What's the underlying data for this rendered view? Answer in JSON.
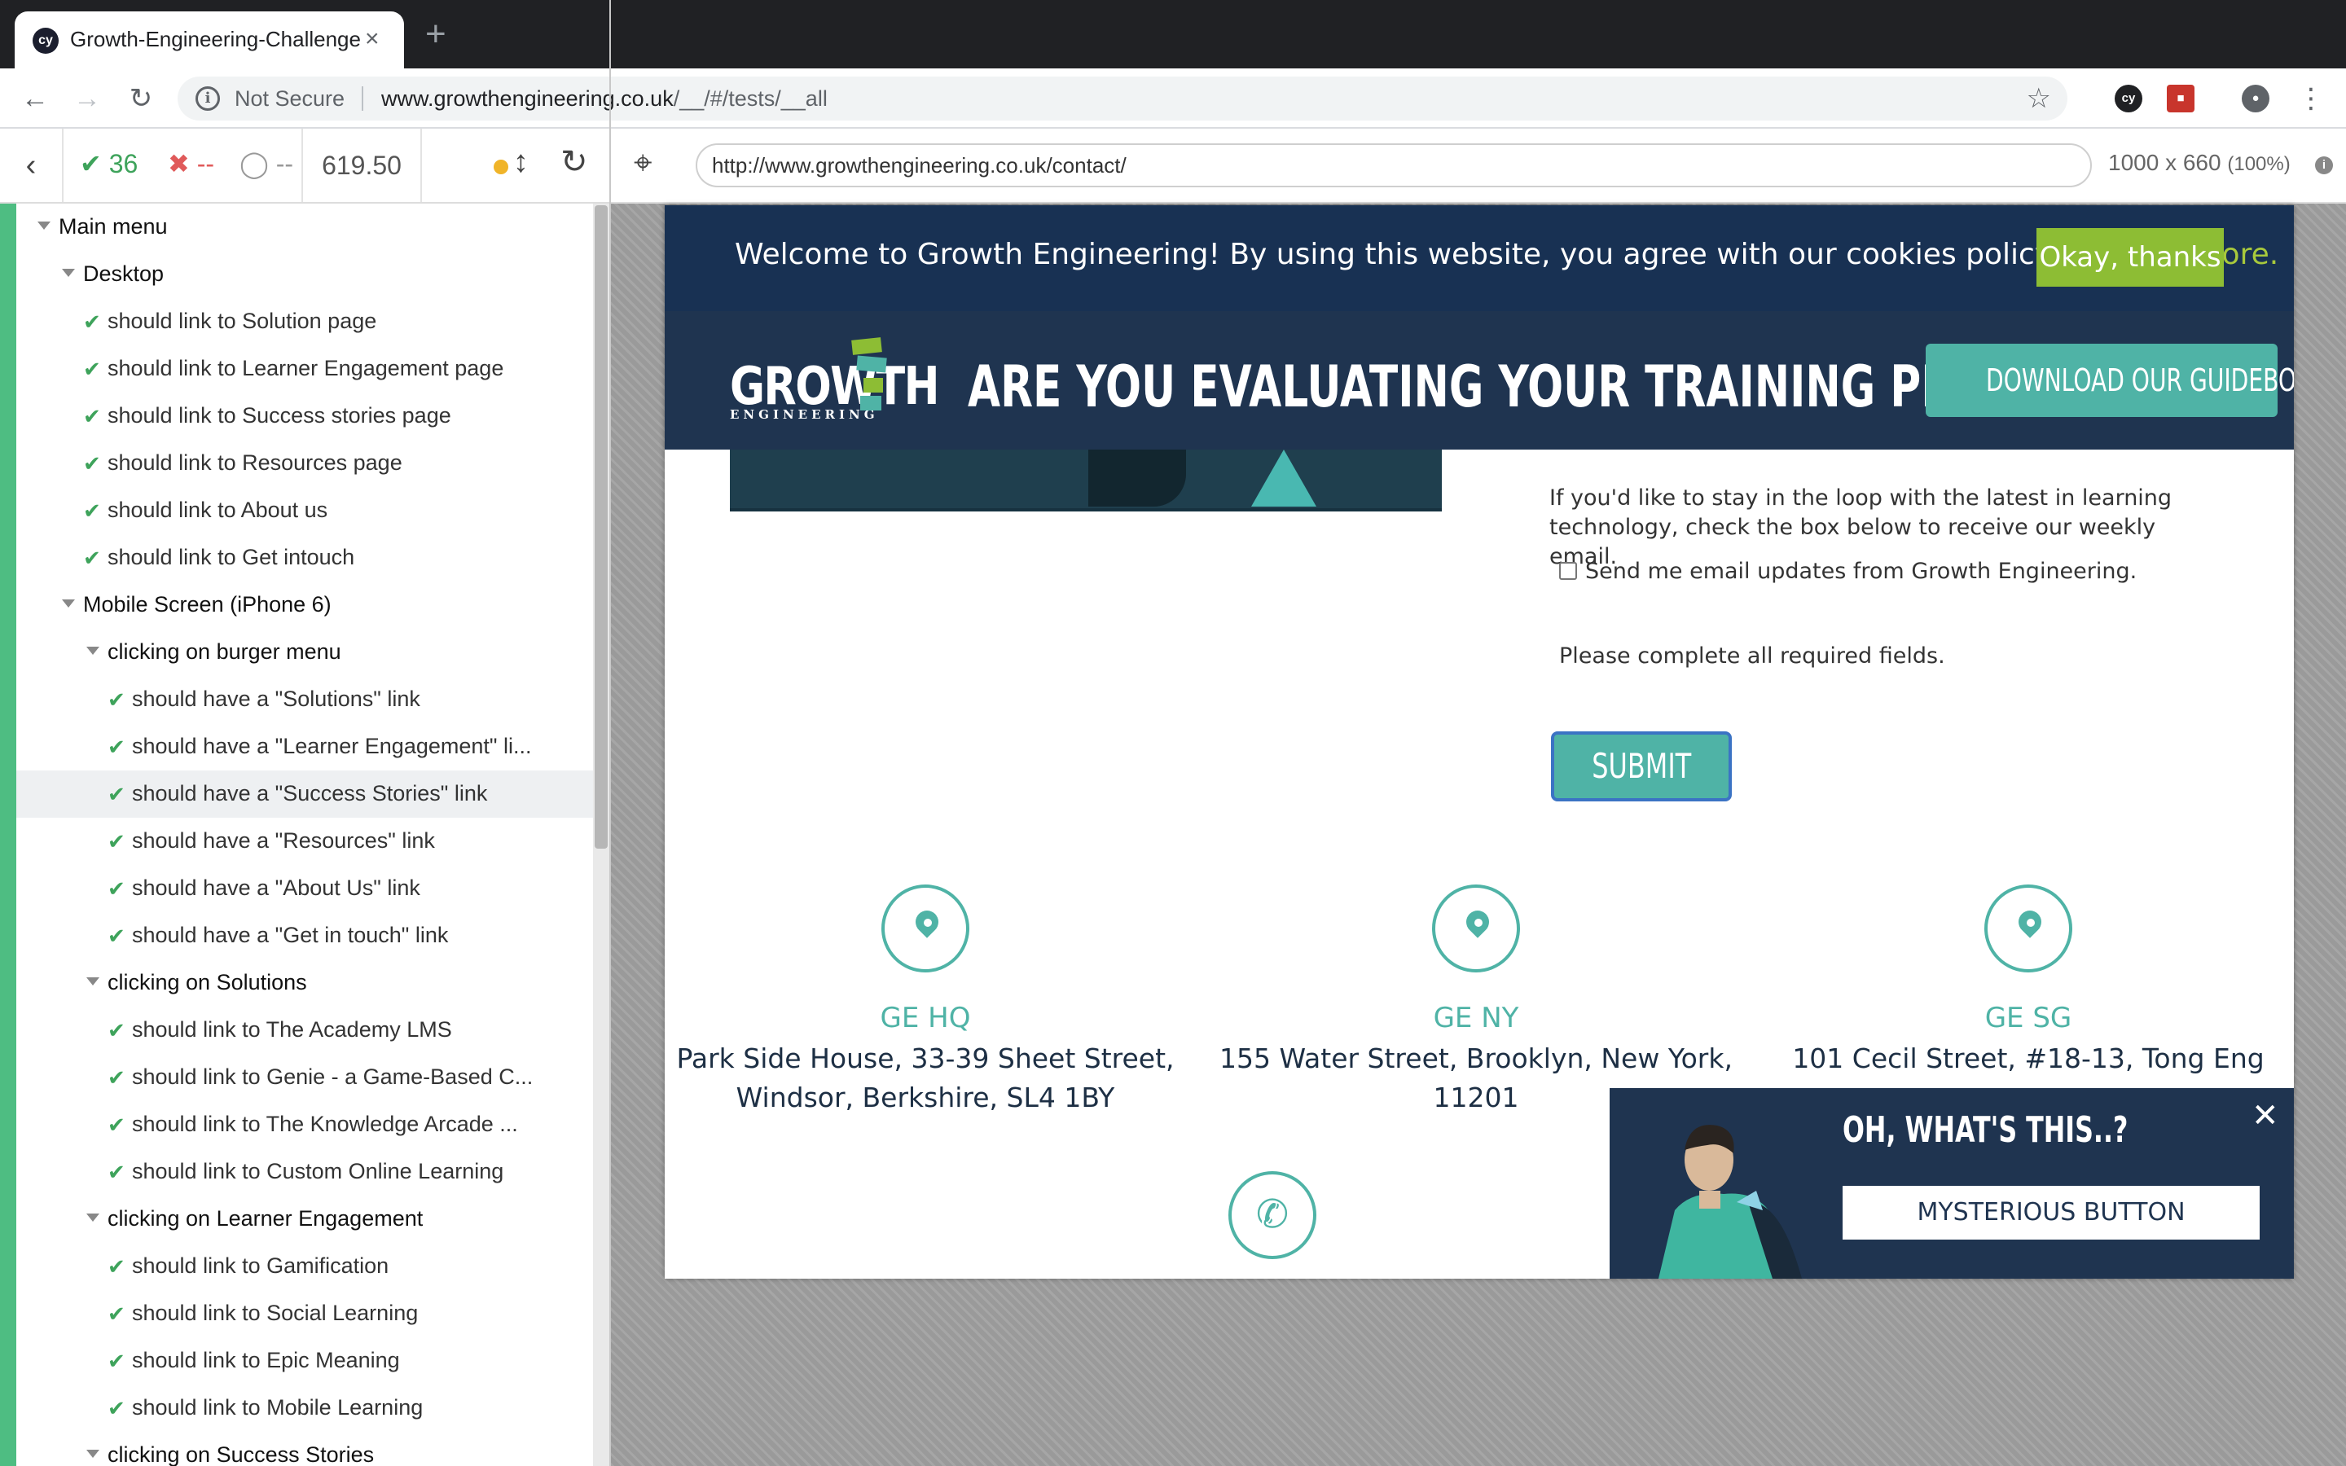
{
  "browser": {
    "tab_title": "Growth-Engineering-Challenge",
    "tab_favicon": "cy",
    "tab_close": "×",
    "new_tab": "+",
    "security_label": "Not Secure",
    "url_host": "www.growthengineering.co.uk",
    "url_path": "/__/#/tests/__all",
    "icons": [
      "back-icon",
      "forward-icon",
      "reload-icon",
      "info-icon",
      "star-icon",
      "cypress-extension-icon",
      "extension-icon",
      "profile-icon",
      "menu-icon"
    ]
  },
  "runner": {
    "passed": "36",
    "failed": "--",
    "pending": "--",
    "duration": "619.50",
    "aut_url": "http://www.growthengineering.co.uk/contact/",
    "viewport": "1000 x 660",
    "viewport_scale": "(100%)",
    "colors": {
      "passed": "#3ea35b",
      "failed": "#e05a5a",
      "running": "#f0b429",
      "sidebar_accent": "#4ebd82"
    }
  },
  "tests": [
    {
      "text": "Main menu",
      "kind": "suite",
      "level": 0
    },
    {
      "text": "Desktop",
      "kind": "suite",
      "level": 1
    },
    {
      "text": "should link to Solution page",
      "kind": "test",
      "level": 2
    },
    {
      "text": "should link to Learner Engagement page",
      "kind": "test",
      "level": 2
    },
    {
      "text": "should link to Success stories page",
      "kind": "test",
      "level": 2
    },
    {
      "text": "should link to Resources page",
      "kind": "test",
      "level": 2
    },
    {
      "text": "should link to About us",
      "kind": "test",
      "level": 2
    },
    {
      "text": "should link to Get intouch",
      "kind": "test",
      "level": 2
    },
    {
      "text": "Mobile Screen (iPhone 6)",
      "kind": "suite",
      "level": 1
    },
    {
      "text": "clicking on burger menu",
      "kind": "suite",
      "level": 2
    },
    {
      "text": "should have a \"Solutions\" link",
      "kind": "test",
      "level": 3
    },
    {
      "text": "should have a \"Learner Engagement\" li...",
      "kind": "test",
      "level": 3
    },
    {
      "text": "should have a \"Success Stories\" link",
      "kind": "test",
      "level": 3,
      "active": true
    },
    {
      "text": "should have a \"Resources\" link",
      "kind": "test",
      "level": 3
    },
    {
      "text": "should have a \"About Us\" link",
      "kind": "test",
      "level": 3
    },
    {
      "text": "should have a \"Get in touch\" link",
      "kind": "test",
      "level": 3
    },
    {
      "text": "clicking on Solutions",
      "kind": "suite",
      "level": 2
    },
    {
      "text": "should link to The Academy LMS",
      "kind": "test",
      "level": 3
    },
    {
      "text": "should link to Genie - a Game-Based C...",
      "kind": "test",
      "level": 3
    },
    {
      "text": "should link to The Knowledge Arcade ...",
      "kind": "test",
      "level": 3
    },
    {
      "text": "should link to Custom Online Learning",
      "kind": "test",
      "level": 3
    },
    {
      "text": "clicking on Learner Engagement",
      "kind": "suite",
      "level": 2
    },
    {
      "text": "should link to Gamification",
      "kind": "test",
      "level": 3
    },
    {
      "text": "should link to Social Learning",
      "kind": "test",
      "level": 3
    },
    {
      "text": "should link to Epic Meaning",
      "kind": "test",
      "level": 3
    },
    {
      "text": "should link to Mobile Learning",
      "kind": "test",
      "level": 3
    },
    {
      "text": "clicking on Success Stories",
      "kind": "suite",
      "level": 2
    }
  ],
  "site": {
    "cookie_text": "Welcome to Growth Engineering! By using this website, you agree with our cookies policy.",
    "cookie_link": "Find out more.",
    "cookie_button": "Okay, thanks",
    "logo_main": "GROWTH",
    "logo_sub": "ENGINEERING",
    "headline": "ARE YOU EVALUATING YOUR TRAINING PROPERLY?",
    "guide_button": "DOWNLOAD OUR GUIDEBOOK",
    "newsletter_text": "If you'd like to stay in the loop with the latest in learning technology, check the box below to receive our weekly email.",
    "checkbox_label": "Send me email updates from Growth Engineering.",
    "required_text": "Please complete all required fields.",
    "submit_label": "SUBMIT",
    "offices": [
      {
        "name": "GE HQ",
        "address_1": "Park Side House, 33-39 Sheet Street,",
        "address_2": "Windsor, Berkshire, SL4 1BY"
      },
      {
        "name": "GE NY",
        "address_1": "155 Water Street, Brooklyn, New York,",
        "address_2": "11201"
      },
      {
        "name": "GE SG",
        "address_1": "101 Cecil Street, #18-13, Tong Eng",
        "address_2": ""
      }
    ],
    "popup_title": "OH, WHAT'S THIS..?",
    "popup_close": "✕",
    "popup_button": "MYSTERIOUS BUTTON",
    "colors": {
      "navy": "#1f3450",
      "teal": "#4fb3a6",
      "lime": "#8dbd34"
    }
  }
}
